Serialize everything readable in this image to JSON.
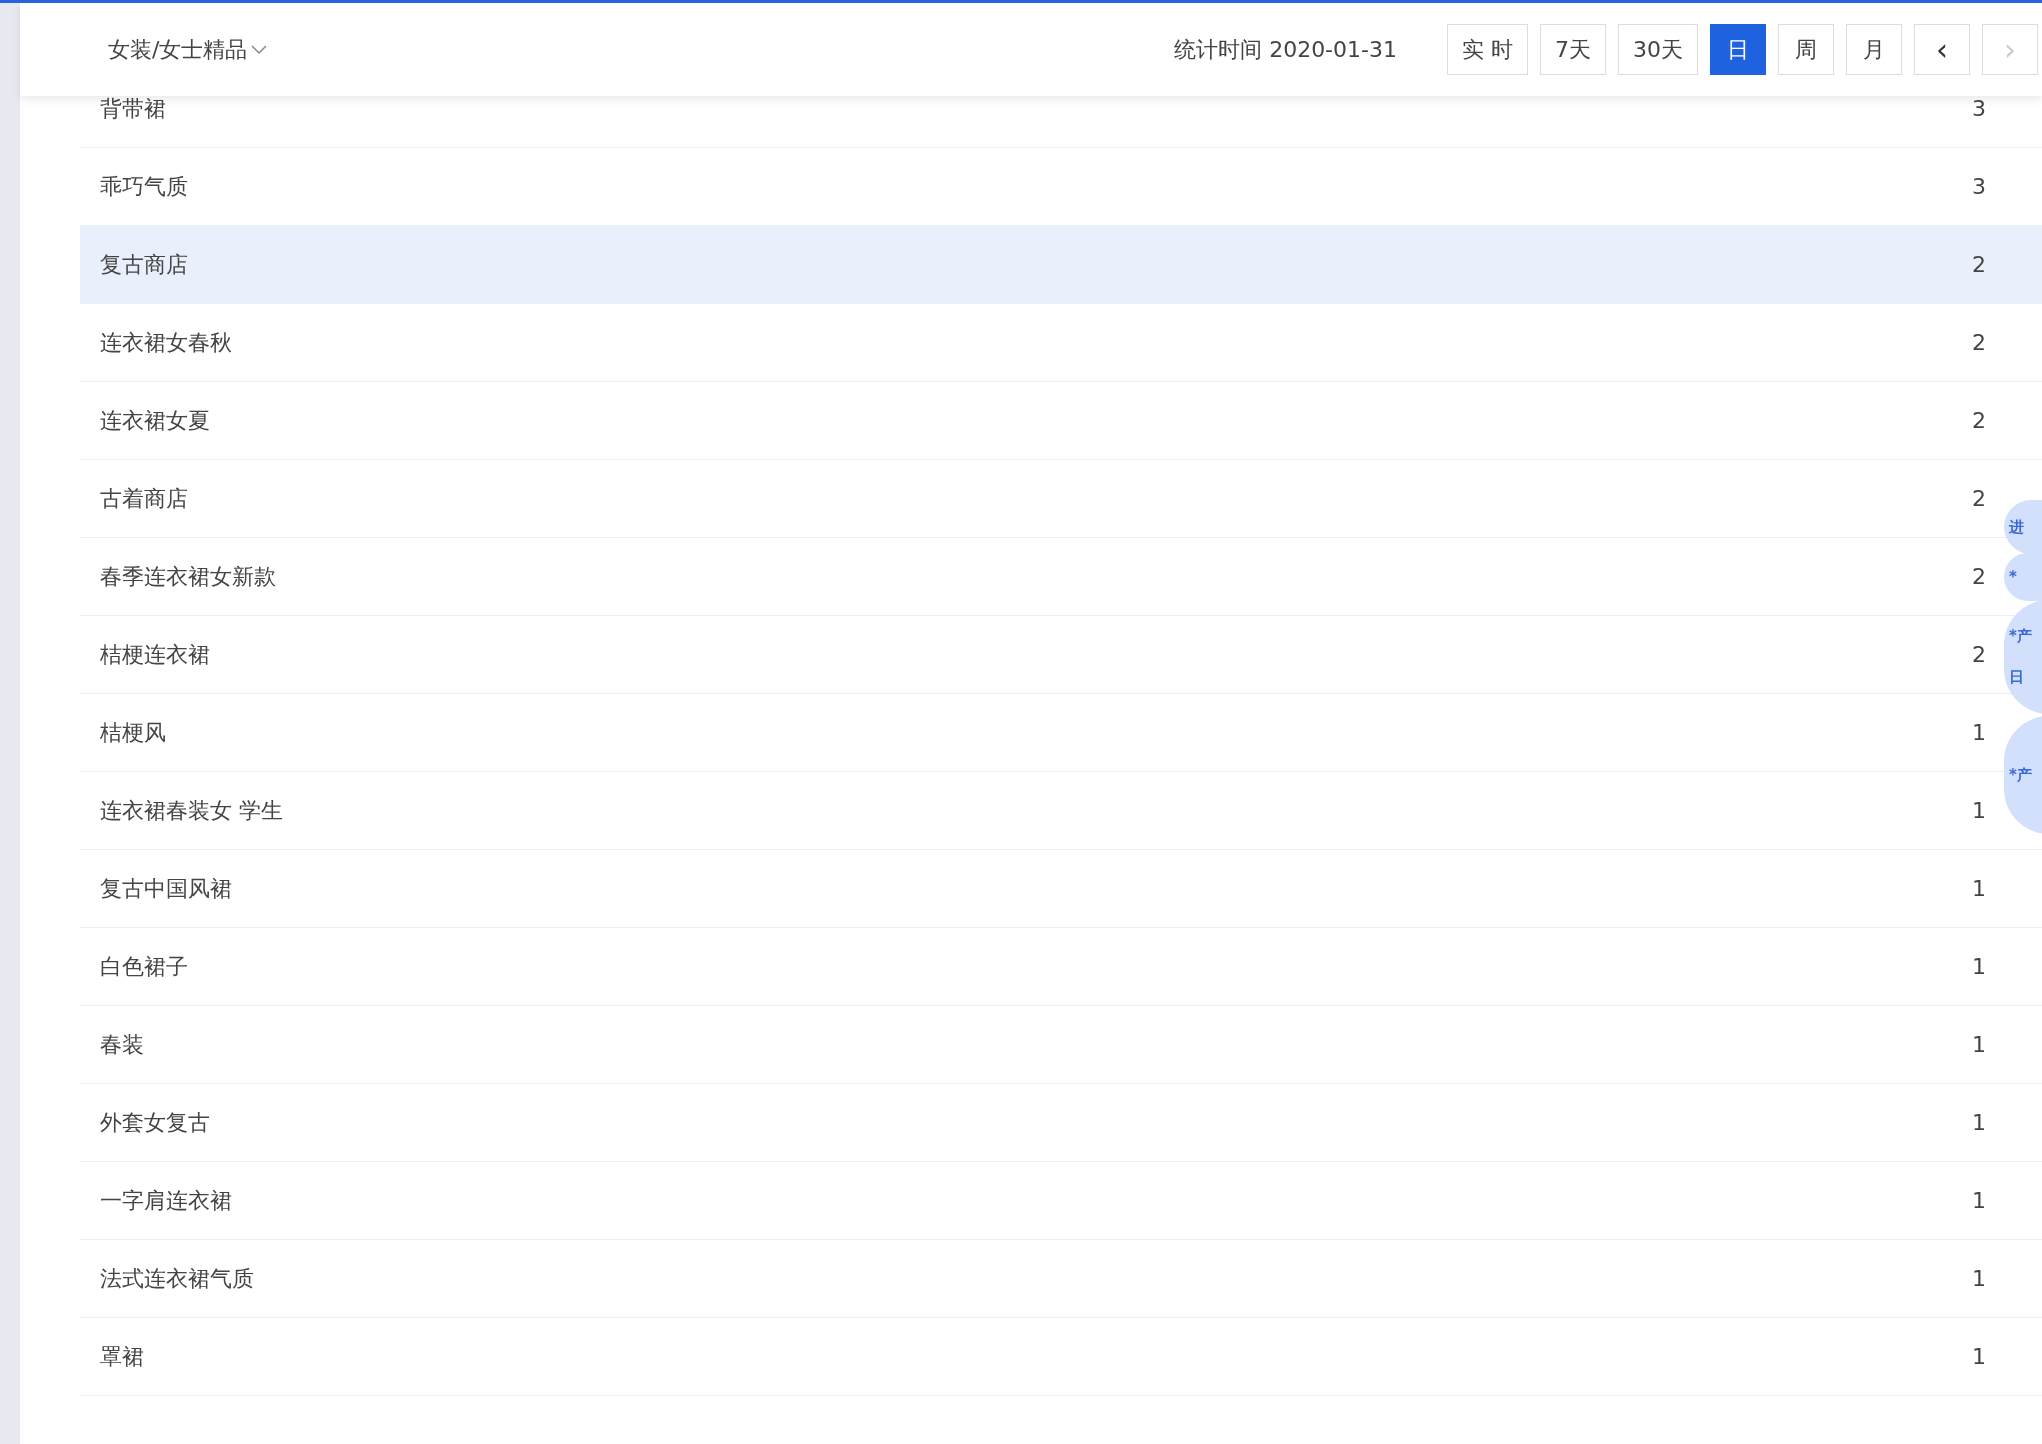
{
  "header": {
    "category": "女装/女士精品",
    "stat_time": "统计时间 2020-01-31",
    "period_buttons": [
      {
        "label": "实 时",
        "selected": false
      },
      {
        "label": "7天",
        "selected": false
      },
      {
        "label": "30天",
        "selected": false
      },
      {
        "label": "日",
        "selected": true
      },
      {
        "label": "周",
        "selected": false
      },
      {
        "label": "月",
        "selected": false
      }
    ],
    "nav_buttons": [
      {
        "label": "‹",
        "disabled": false
      },
      {
        "label": "›",
        "disabled": true
      }
    ]
  },
  "rows": [
    {
      "keyword": "背带裙",
      "value": "3",
      "highlighted": false
    },
    {
      "keyword": "乖巧气质",
      "value": "3",
      "highlighted": false
    },
    {
      "keyword": "复古商店",
      "value": "2",
      "highlighted": true
    },
    {
      "keyword": "连衣裙女春秋",
      "value": "2",
      "highlighted": false
    },
    {
      "keyword": "连衣裙女夏",
      "value": "2",
      "highlighted": false
    },
    {
      "keyword": "古着商店",
      "value": "2",
      "highlighted": false
    },
    {
      "keyword": "春季连衣裙女新款",
      "value": "2",
      "highlighted": false
    },
    {
      "keyword": "桔梗连衣裙",
      "value": "2",
      "highlighted": false
    },
    {
      "keyword": "桔梗风",
      "value": "1",
      "highlighted": false
    },
    {
      "keyword": "连衣裙春装女 学生",
      "value": "1",
      "highlighted": false
    },
    {
      "keyword": "复古中国风裙",
      "value": "1",
      "highlighted": false
    },
    {
      "keyword": "白色裙子",
      "value": "1",
      "highlighted": false
    },
    {
      "keyword": "春装",
      "value": "1",
      "highlighted": false
    },
    {
      "keyword": "外套女复古",
      "value": "1",
      "highlighted": false
    },
    {
      "keyword": "一字肩连衣裙",
      "value": "1",
      "highlighted": false
    },
    {
      "keyword": "法式连衣裙气质",
      "value": "1",
      "highlighted": false
    },
    {
      "keyword": "罩裙",
      "value": "1",
      "highlighted": false
    }
  ],
  "side_bubbles": [
    {
      "lines": [
        "进"
      ]
    },
    {
      "lines": [
        "*"
      ]
    },
    {
      "lines": [
        "*产",
        "日"
      ]
    },
    {
      "lines": [
        "*产"
      ]
    }
  ]
}
